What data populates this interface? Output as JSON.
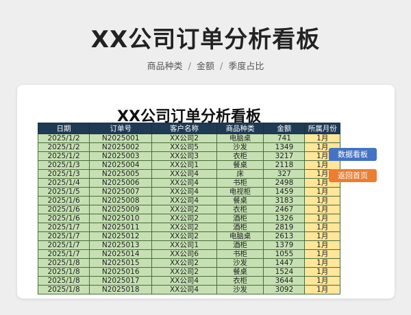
{
  "page": {
    "title": "XX公司订单分析看板",
    "subtitle_items": [
      "商品种类",
      "金额",
      "季度占比"
    ],
    "separator": "/"
  },
  "sheet": {
    "title": "XX公司订单分析看板",
    "headers": [
      "日期",
      "订单号",
      "客户名称",
      "商品种类",
      "金额",
      "所属月份"
    ],
    "rows": [
      [
        "2025/1/2",
        "N2025001",
        "XX公司2",
        "电脑桌",
        "741",
        "1月"
      ],
      [
        "2025/1/2",
        "N2025002",
        "XX公司5",
        "沙发",
        "1349",
        "1月"
      ],
      [
        "2025/1/2",
        "N2025003",
        "XX公司3",
        "衣柜",
        "3217",
        "1月"
      ],
      [
        "2025/1/3",
        "N2025004",
        "XX公司1",
        "餐桌",
        "2118",
        "1月"
      ],
      [
        "2025/1/3",
        "N2025005",
        "XX公司4",
        "床",
        "327",
        "1月"
      ],
      [
        "2025/1/4",
        "N2025006",
        "XX公司4",
        "书柜",
        "2498",
        "1月"
      ],
      [
        "2025/1/5",
        "N2025007",
        "XX公司4",
        "电视柜",
        "1459",
        "1月"
      ],
      [
        "2025/1/6",
        "N2025008",
        "XX公司4",
        "餐桌",
        "3183",
        "1月"
      ],
      [
        "2025/1/6",
        "N2025009",
        "XX公司2",
        "衣柜",
        "2467",
        "1月"
      ],
      [
        "2025/1/6",
        "N2025010",
        "XX公司2",
        "酒柜",
        "1326",
        "1月"
      ],
      [
        "2025/1/7",
        "N2025011",
        "XX公司2",
        "酒柜",
        "2819",
        "1月"
      ],
      [
        "2025/1/7",
        "N2025012",
        "XX公司2",
        "电脑桌",
        "2613",
        "1月"
      ],
      [
        "2025/1/7",
        "N2025013",
        "XX公司1",
        "酒柜",
        "1379",
        "1月"
      ],
      [
        "2025/1/7",
        "N2025014",
        "XX公司6",
        "书柜",
        "1055",
        "1月"
      ],
      [
        "2025/1/8",
        "N2025015",
        "XX公司2",
        "沙发",
        "1447",
        "1月"
      ],
      [
        "2025/1/8",
        "N2025016",
        "XX公司2",
        "餐桌",
        "1524",
        "1月"
      ],
      [
        "2025/1/8",
        "N2025017",
        "XX公司4",
        "衣柜",
        "3644",
        "1月"
      ],
      [
        "2025/1/8",
        "N2025018",
        "XX公司4",
        "沙发",
        "3092",
        "1月"
      ]
    ]
  },
  "buttons": {
    "dashboard": "数据看板",
    "home": "返回首页"
  },
  "colors": {
    "header_bg": "#1f3a55",
    "row_bg": "#c6e0b4",
    "month_bg": "#ffe699",
    "btn_dashboard": "#4472c4",
    "btn_home": "#ed7d31"
  }
}
